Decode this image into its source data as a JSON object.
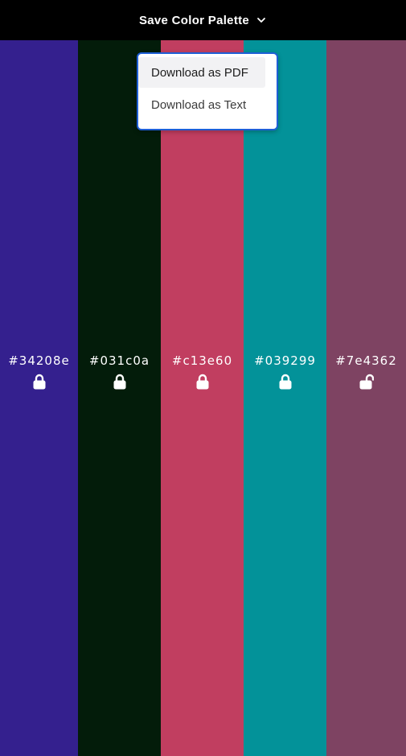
{
  "header": {
    "save_label": "Save Color Palette"
  },
  "palette": [
    {
      "hex": "#34208e",
      "locked": true
    },
    {
      "hex": "#031c0a",
      "locked": true
    },
    {
      "hex": "#c13e60",
      "locked": true
    },
    {
      "hex": "#039299",
      "locked": true
    },
    {
      "hex": "#7e4362",
      "locked": false
    }
  ],
  "dropdown": {
    "items": [
      {
        "label": "Download as PDF"
      },
      {
        "label": "Download as Text"
      }
    ]
  },
  "colors": {
    "header_bg": "#000000",
    "dropdown_border": "#1e5fd6",
    "hover_bg": "#f2f2f4"
  }
}
